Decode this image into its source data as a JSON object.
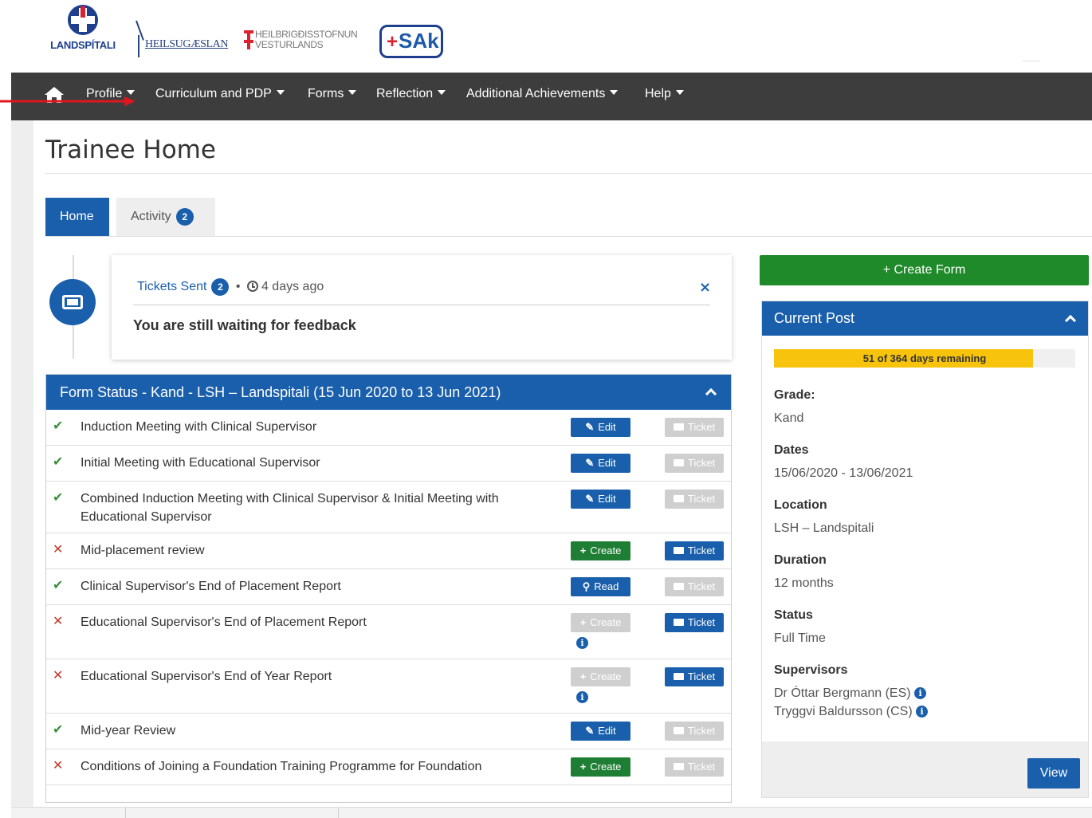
{
  "logos": {
    "landspitali": "LANDSPÍTALI",
    "heilsugaeslan": "HEILSUGÆSLAN",
    "hve_line1": "HEILBRIGÐISSTOFNUN",
    "hve_line2": "VESTURLANDS",
    "sak": "SAk"
  },
  "nav": {
    "items": [
      {
        "label": "Profile"
      },
      {
        "label": "Curriculum and PDP"
      },
      {
        "label": "Forms"
      },
      {
        "label": "Reflection"
      },
      {
        "label": "Additional Achievements"
      },
      {
        "label": "Help"
      }
    ]
  },
  "page": {
    "title": "Trainee Home"
  },
  "tabs": {
    "home": "Home",
    "activity": "Activity",
    "activity_count": "2"
  },
  "notification": {
    "source": "Tickets Sent",
    "count": "2",
    "separator": "•",
    "time": "4 days ago",
    "close": "×",
    "message": "You are still waiting for feedback"
  },
  "form_status": {
    "title": "Form Status - Kand - LSH – Landspitali (15 Jun 2020 to 13 Jun 2021)",
    "rows": [
      {
        "status": "✔",
        "name": "Induction Meeting with Clinical Supervisor",
        "action_icon": "✎",
        "action": "Edit",
        "ticket": "Ticket"
      },
      {
        "status": "✔",
        "name": "Initial Meeting with Educational Supervisor",
        "action_icon": "✎",
        "action": "Edit",
        "ticket": "Ticket"
      },
      {
        "status": "✔",
        "name": "Combined Induction Meeting with Clinical Supervisor & Initial Meeting with Educational Supervisor",
        "action_icon": "✎",
        "action": "Edit",
        "ticket": "Ticket"
      },
      {
        "status": "✕",
        "name": "Mid-placement review",
        "action_icon": "+",
        "action": "Create",
        "ticket": "Ticket"
      },
      {
        "status": "✔",
        "name": "Clinical Supervisor's End of Placement Report",
        "action_icon": "⚲",
        "action": "Read",
        "ticket": "Ticket"
      },
      {
        "status": "✕",
        "name": "Educational Supervisor's End of Placement Report",
        "action_icon": "+",
        "action": "Create",
        "ticket": "Ticket",
        "info": "i"
      },
      {
        "status": "✕",
        "name": "Educational Supervisor's End of Year Report",
        "action_icon": "+",
        "action": "Create",
        "ticket": "Ticket",
        "info": "i"
      },
      {
        "status": "✔",
        "name": "Mid-year Review",
        "action_icon": "✎",
        "action": "Edit",
        "ticket": "Ticket"
      },
      {
        "status": "✕",
        "name": "Conditions of Joining a Foundation Training Programme for Foundation",
        "action_icon": "+",
        "action": "Create",
        "ticket": "Ticket"
      }
    ]
  },
  "sidebar": {
    "create_form": "+ Create Form",
    "current_post": {
      "title": "Current Post",
      "progress_label": "51 of 364 days remaining",
      "progress_fraction": 0.86,
      "grade_label": "Grade:",
      "grade": "Kand",
      "dates_label": "Dates",
      "dates": "15/06/2020 - 13/06/2021",
      "location_label": "Location",
      "location": "LSH – Landspitali",
      "duration_label": "Duration",
      "duration": "12 months",
      "status_label": "Status",
      "status": "Full Time",
      "supervisors_label": "Supervisors",
      "supervisor_es": "Dr Óttar Bergmann (ES)",
      "supervisor_cs": "Tryggvi Baldursson (CS)",
      "info": "i",
      "view": "View"
    }
  },
  "colors": {
    "primary": "#1a5fac",
    "nav_bg": "#3d3d3d",
    "success": "#1e7e34",
    "progress": "#f7c30c",
    "danger": "#c0392b"
  }
}
